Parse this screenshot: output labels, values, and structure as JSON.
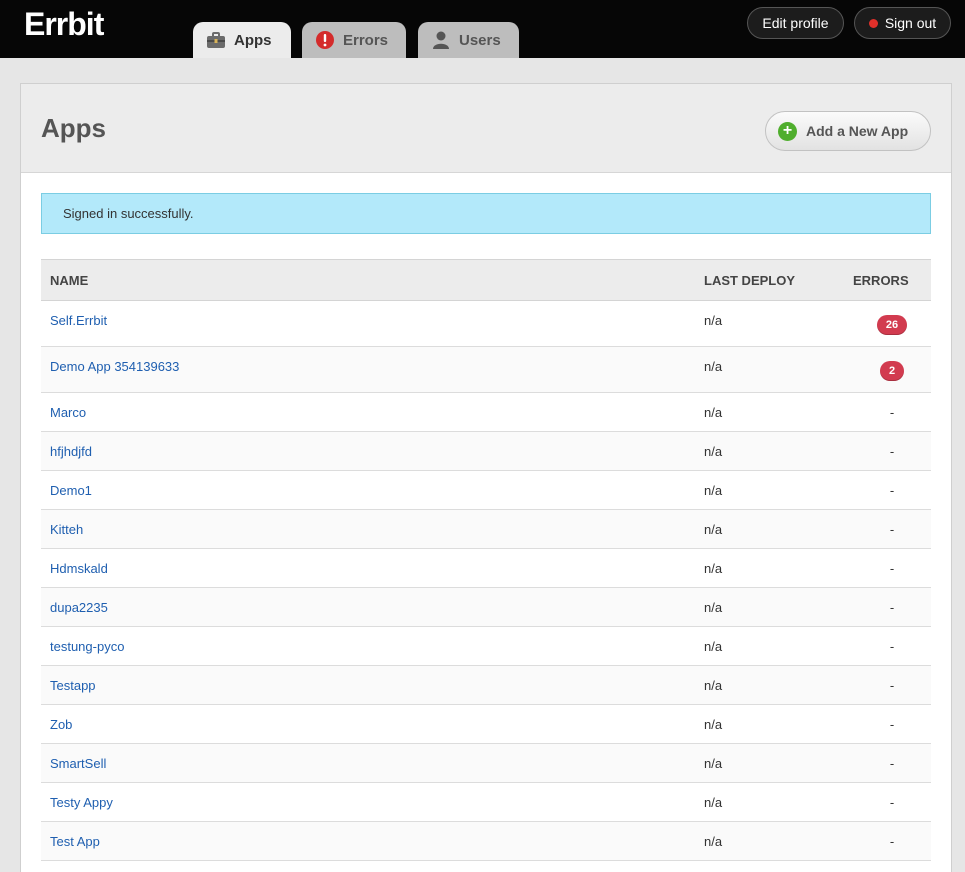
{
  "app": {
    "logo": "Errbit"
  },
  "nav": {
    "tabs": [
      {
        "label": "Apps",
        "icon": "briefcase-icon",
        "active": true
      },
      {
        "label": "Errors",
        "icon": "alert-icon",
        "active": false
      },
      {
        "label": "Users",
        "icon": "user-icon",
        "active": false
      }
    ],
    "edit_profile": "Edit profile",
    "sign_out": "Sign out"
  },
  "page": {
    "title": "Apps",
    "add_button": "Add a New App",
    "notice": "Signed in successfully."
  },
  "table": {
    "headers": {
      "name": "NAME",
      "last_deploy": "LAST DEPLOY",
      "errors": "ERRORS"
    },
    "rows": [
      {
        "name": "Self.Errbit",
        "last_deploy": "n/a",
        "errors": "26"
      },
      {
        "name": "Demo App 354139633",
        "last_deploy": "n/a",
        "errors": "2"
      },
      {
        "name": "Marco",
        "last_deploy": "n/a",
        "errors": "-"
      },
      {
        "name": "hfjhdjfd",
        "last_deploy": "n/a",
        "errors": "-"
      },
      {
        "name": "Demo1",
        "last_deploy": "n/a",
        "errors": "-"
      },
      {
        "name": "Kitteh",
        "last_deploy": "n/a",
        "errors": "-"
      },
      {
        "name": "Hdmskald",
        "last_deploy": "n/a",
        "errors": "-"
      },
      {
        "name": "dupa2235",
        "last_deploy": "n/a",
        "errors": "-"
      },
      {
        "name": "testung-pyco",
        "last_deploy": "n/a",
        "errors": "-"
      },
      {
        "name": "Testapp",
        "last_deploy": "n/a",
        "errors": "-"
      },
      {
        "name": "Zob",
        "last_deploy": "n/a",
        "errors": "-"
      },
      {
        "name": "SmartSell",
        "last_deploy": "n/a",
        "errors": "-"
      },
      {
        "name": "Testy Appy",
        "last_deploy": "n/a",
        "errors": "-"
      },
      {
        "name": "Test App",
        "last_deploy": "n/a",
        "errors": "-"
      },
      {
        "name": "",
        "last_deploy": "",
        "errors": ""
      }
    ]
  },
  "colors": {
    "accent_link": "#1f5fb0",
    "badge": "#d23b4f",
    "notice_bg": "#b3e9fa",
    "topbar": "#060606"
  }
}
